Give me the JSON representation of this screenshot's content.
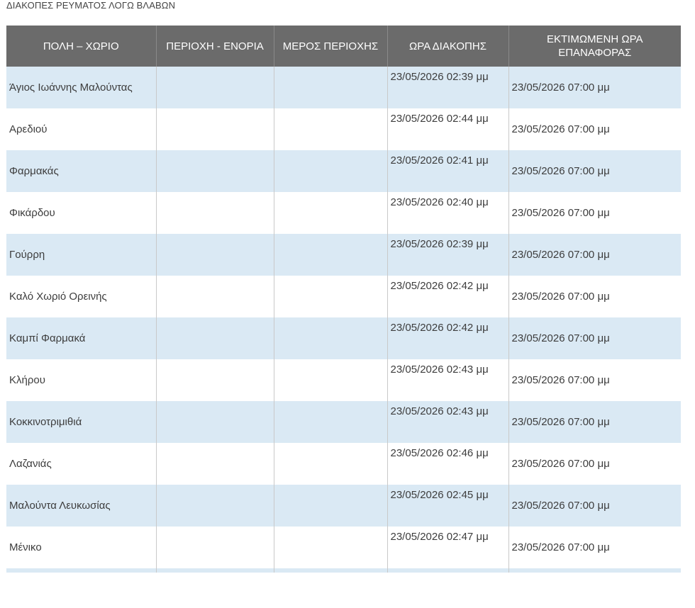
{
  "page_title": "ΔΙΑΚΟΠΕΣ ΡΕΥΜΑΤΟΣ ΛΟΓΩ ΒΛΑΒΩΝ",
  "table": {
    "headers": [
      "ΠΟΛΗ – ΧΩΡΙΟ",
      "ΠΕΡΙΟΧΗ - ΕΝΟΡΙΑ",
      "ΜΕΡΟΣ ΠΕΡΙΟΧΗΣ",
      "ΩΡΑ ΔΙΑΚΟΠΗΣ",
      "ΕΚΤΙΜΩΜΕΝΗ ΩΡΑ ΕΠΑΝΑΦΟΡΑΣ"
    ],
    "rows": [
      {
        "town": "Άγιος Ιωάννης Μαλούντας",
        "area": "",
        "part": "",
        "cut_time": "23/05/2026 02:39 μμ",
        "restore_time": "23/05/2026 07:00 μμ"
      },
      {
        "town": "Αρεδιού",
        "area": "",
        "part": "",
        "cut_time": "23/05/2026 02:44 μμ",
        "restore_time": "23/05/2026 07:00 μμ"
      },
      {
        "town": "Φαρμακάς",
        "area": "",
        "part": "",
        "cut_time": "23/05/2026 02:41 μμ",
        "restore_time": "23/05/2026 07:00 μμ"
      },
      {
        "town": "Φικάρδου",
        "area": "",
        "part": "",
        "cut_time": "23/05/2026 02:40 μμ",
        "restore_time": "23/05/2026 07:00 μμ"
      },
      {
        "town": "Γούρρη",
        "area": "",
        "part": "",
        "cut_time": "23/05/2026 02:39 μμ",
        "restore_time": "23/05/2026 07:00 μμ"
      },
      {
        "town": "Καλό Χωριό Ορεινής",
        "area": "",
        "part": "",
        "cut_time": "23/05/2026 02:42 μμ",
        "restore_time": "23/05/2026 07:00 μμ"
      },
      {
        "town": "Καμπί Φαρμακά",
        "area": "",
        "part": "",
        "cut_time": "23/05/2026 02:42 μμ",
        "restore_time": "23/05/2026 07:00 μμ"
      },
      {
        "town": "Κλήρου",
        "area": "",
        "part": "",
        "cut_time": "23/05/2026 02:43 μμ",
        "restore_time": "23/05/2026 07:00 μμ"
      },
      {
        "town": "Κοκκινοτριμιθιά",
        "area": "",
        "part": "",
        "cut_time": "23/05/2026 02:43 μμ",
        "restore_time": "23/05/2026 07:00 μμ"
      },
      {
        "town": "Λαζανιάς",
        "area": "",
        "part": "",
        "cut_time": "23/05/2026 02:46 μμ",
        "restore_time": "23/05/2026 07:00 μμ"
      },
      {
        "town": "Μαλούντα Λευκωσίας",
        "area": "",
        "part": "",
        "cut_time": "23/05/2026 02:45 μμ",
        "restore_time": "23/05/2026 07:00 μμ"
      },
      {
        "town": "Μένικο",
        "area": "",
        "part": "",
        "cut_time": "23/05/2026 02:47 μμ",
        "restore_time": "23/05/2026 07:00 μμ"
      }
    ]
  },
  "colors": {
    "header_bg": "#6b6b6b",
    "odd_row_bg": "#dae9f4",
    "even_row_bg": "#ffffff",
    "text": "#3d3d3d"
  }
}
